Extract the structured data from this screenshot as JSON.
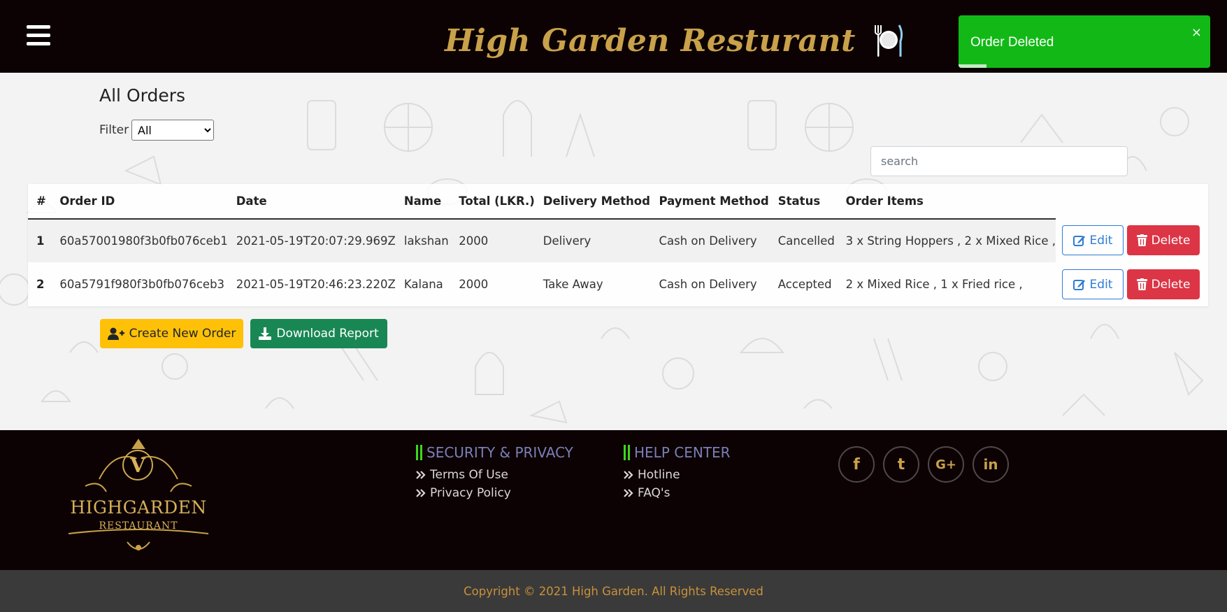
{
  "header": {
    "brand_title": "High Garden Resturant",
    "menu_icon": "hamburger-menu-icon",
    "brand_icon": "plate-and-cutlery-icon",
    "background": "#0c0203",
    "brand_color": "#c9a14a"
  },
  "toast": {
    "message": "Order Deleted",
    "close_symbol": "×",
    "background": "#12b916",
    "progress": 0.11
  },
  "main": {
    "title": "All Orders",
    "filter": {
      "label": "Filter",
      "selected": "All",
      "options": [
        "All"
      ]
    },
    "search": {
      "placeholder": "search"
    },
    "table": {
      "headers": [
        "#",
        "Order ID",
        "Date",
        "Name",
        "Total (LKR.)",
        "Delivery Method",
        "Payment Method",
        "Status",
        "Order Items"
      ],
      "rows": [
        {
          "num": "1",
          "order_id": "60a57001980f3b0fb076ceb1",
          "date": "2021-05-19T20:07:29.969Z",
          "name": "lakshan",
          "total": "2000",
          "delivery": "Delivery",
          "payment": "Cash on Delivery",
          "status": "Cancelled",
          "items": "3 x String Hoppers , 2 x Mixed Rice ,"
        },
        {
          "num": "2",
          "order_id": "60a5791f980f3b0fb076ceb3",
          "date": "2021-05-19T20:46:23.220Z",
          "name": "Kalana",
          "total": "2000",
          "delivery": "Take Away",
          "payment": "Cash on Delivery",
          "status": "Accepted",
          "items": "2 x Mixed Rice , 1 x Fried rice ,"
        }
      ],
      "edit_label": "Edit",
      "delete_label": "Delete",
      "edit_icon": "edit-square-icon",
      "delete_icon": "trash-icon"
    },
    "create_button": {
      "label": "Create New Order",
      "icon": "user-plus-icon",
      "color": "#ffc107"
    },
    "download_button": {
      "label": "Download Report",
      "icon": "download-icon",
      "color": "#198754"
    }
  },
  "footer": {
    "logo": {
      "monogram": "V",
      "name": "HIGHGARDEN",
      "sub": "RESTAURANT"
    },
    "security": {
      "heading": "SECURITY & PRIVACY",
      "links": [
        "Terms Of Use",
        "Privacy Policy"
      ]
    },
    "help": {
      "heading": "HELP CENTER",
      "links": [
        "Hotline",
        "FAQ's"
      ]
    },
    "socials": [
      {
        "name": "facebook-icon",
        "glyph": "f"
      },
      {
        "name": "twitter-icon",
        "glyph": "t"
      },
      {
        "name": "google-plus-icon",
        "glyph": "G+"
      },
      {
        "name": "linkedin-icon",
        "glyph": "in"
      }
    ],
    "accent_color": "#40d61d"
  },
  "copyright": "Copyright © 2021 High Garden. All Rights Reserved"
}
